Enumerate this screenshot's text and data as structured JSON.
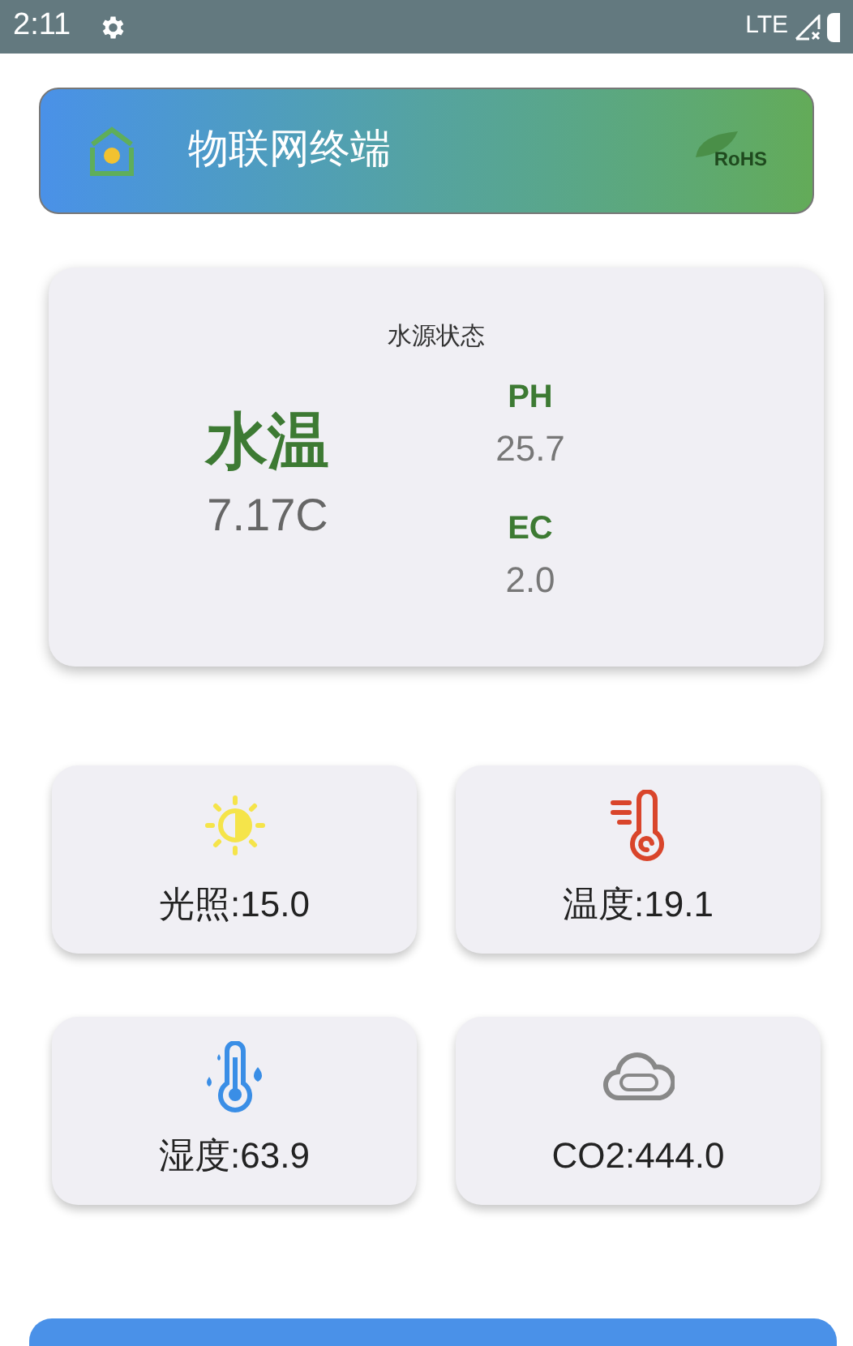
{
  "status_bar": {
    "time": "2:11",
    "network": "LTE"
  },
  "header": {
    "title": "物联网终端",
    "logo_text": "RoHS"
  },
  "water": {
    "title": "水源状态",
    "main": {
      "label": "水温",
      "value": "7.17C"
    },
    "metrics": [
      {
        "label": "PH",
        "value": "25.7"
      },
      {
        "label": "EC",
        "value": "2.0"
      }
    ]
  },
  "sensors": [
    {
      "kind": "light",
      "text": "光照:15.0"
    },
    {
      "kind": "temperature",
      "text": "温度:19.1"
    },
    {
      "kind": "humidity",
      "text": "湿度:63.9"
    },
    {
      "kind": "co2",
      "text": "CO2:444.0"
    }
  ]
}
